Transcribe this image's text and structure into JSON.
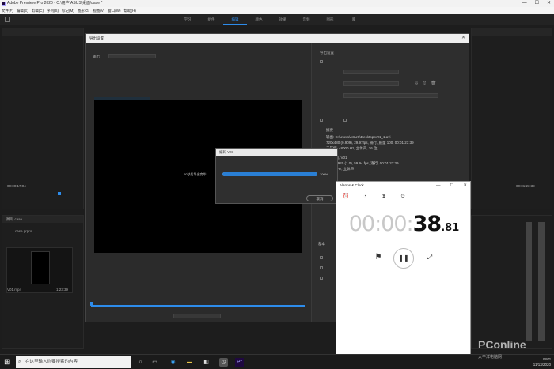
{
  "premiere": {
    "title": "Adobe Premiere Pro 2020 - C:\\用户\\ASUS\\桌面\\case *",
    "menu": [
      "文件(F)",
      "编辑(E)",
      "剪辑(C)",
      "序列(S)",
      "标记(M)",
      "图形(G)",
      "视图(V)",
      "窗口(W)",
      "帮助(H)"
    ],
    "workspace_tabs": [
      "学习",
      "组件",
      "编辑",
      "颜色",
      "效果",
      "音频",
      "图形",
      "库"
    ],
    "active_workspace": 2,
    "source_timecode": "00:00:17:04",
    "program_timecode": "00:01:23:39",
    "project_panel_title": "项目: case",
    "project_file": "case.prproj",
    "clip_name": "V01.mp4",
    "clip_duration": "1:23:39"
  },
  "export_dialog": {
    "title": "导出设置",
    "close_icon": "close-icon",
    "source_tab": "输出",
    "right_header": "导出设置",
    "summary_label": "摘要",
    "output_lines": [
      "输出: C:\\Users\\ASUS\\Desktop\\V01_1.avi",
      "720x480 (0.909), 29.97fps, 隔行, 质量 100, 00:01:23:39",
      "未压缩, 48000 Hz, 立体声, 16 位"
    ],
    "source_lines": [
      "源: 序列, V01",
      "1080x1920 (1.0), 59.94 fps, 逐行, 00:01:23:39",
      "48000 Hz, 立体声"
    ],
    "basic_label": "基本"
  },
  "render_dialog": {
    "title": "编码 V01",
    "status": "00秒后导出完毕",
    "progress_percent": 100,
    "progress_label": "100%",
    "cancel_label": "取消"
  },
  "clock_app": {
    "title": "Alarms & Clock",
    "tabs": [
      "alarm-icon",
      "world-clock-icon",
      "timer-icon",
      "stopwatch-icon"
    ],
    "active_tab": 3,
    "time_grey": "00:00:",
    "time_secs": "38",
    "time_ms": ".81",
    "minimize": "—",
    "maximize": "☐",
    "close": "✕"
  },
  "taskbar": {
    "search_placeholder": "在这里输入你要搜索的内容",
    "time": "11/13/2020",
    "tray": "ENG"
  },
  "watermark": {
    "brand": "PConline",
    "sub": "太平洋电脑网"
  },
  "colors": {
    "accent_blue": "#2d8ceb",
    "progress_blue": "#2a7fd4",
    "windows_blue": "#0078d4"
  }
}
